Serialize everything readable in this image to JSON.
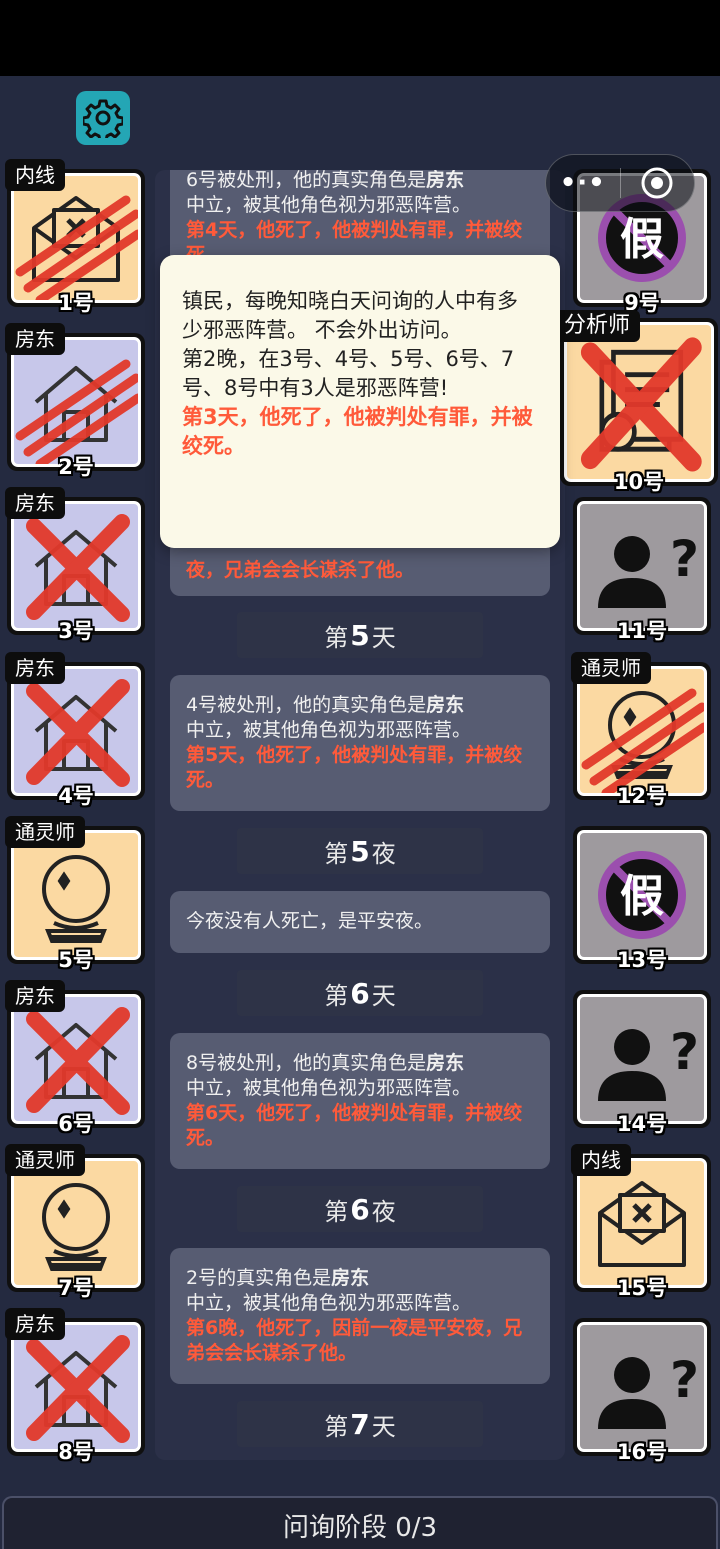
{
  "log": {
    "entries": [
      {
        "id": "e0",
        "normal": "6号被处刑，他的真实角色是",
        "bold": "房东",
        "line2": "中立，被其他角色视为邪恶阵营。",
        "red": "第4天，他死了，他被判处有罪，并被绞死。"
      },
      {
        "id": "e1",
        "red": "夜，兄弟会会长谋杀了他。"
      },
      {
        "id": "e2",
        "normal": "4号被处刑，他的真实角色是",
        "bold": "房东",
        "line2": "中立，被其他角色视为邪恶阵营。",
        "red": "第5天，他死了，他被判处有罪，并被绞死。"
      },
      {
        "id": "e3",
        "normal": "今夜没有人死亡，是平安夜。"
      },
      {
        "id": "e4",
        "normal": "8号被处刑，他的真实角色是",
        "bold": "房东",
        "line2": "中立，被其他角色视为邪恶阵营。",
        "red": "第6天，他死了，他被判处有罪，并被绞死。"
      },
      {
        "id": "e5",
        "normal": "2号的真实角色是",
        "bold": "房东",
        "line2": "中立，被其他角色视为邪恶阵营。",
        "red": "第6晚，他死了，因前一夜是平安夜，兄弟会会长谋杀了他。"
      }
    ],
    "headers": [
      {
        "prefix": "第",
        "num": "5",
        "suffix": "天"
      },
      {
        "prefix": "第",
        "num": "5",
        "suffix": "夜"
      },
      {
        "prefix": "第",
        "num": "6",
        "suffix": "天"
      },
      {
        "prefix": "第",
        "num": "6",
        "suffix": "夜"
      },
      {
        "prefix": "第",
        "num": "7",
        "suffix": "天"
      }
    ]
  },
  "popup": {
    "desc": "镇民，每晚知晓白天问询的人中有多少邪恶阵营。 不会外出访问。",
    "result": "第2晚，在3号、4号、5号、6号、7号、8号中有3人是邪恶阵营!",
    "death": "第3天，他死了，他被判处有罪，并被绞死。"
  },
  "players_left": [
    {
      "number": "1号",
      "role": "内线",
      "icon": "envelope-icon",
      "state": "slashed"
    },
    {
      "number": "2号",
      "role": "房东",
      "icon": "house-icon",
      "state": "slashed"
    },
    {
      "number": "3号",
      "role": "房东",
      "icon": "house-icon",
      "state": "crossed"
    },
    {
      "number": "4号",
      "role": "房东",
      "icon": "house-icon",
      "state": "crossed"
    },
    {
      "number": "5号",
      "role": "通灵师",
      "icon": "crystal-ball-icon",
      "state": "alive"
    },
    {
      "number": "6号",
      "role": "房东",
      "icon": "house-icon",
      "state": "crossed"
    },
    {
      "number": "7号",
      "role": "通灵师",
      "icon": "crystal-ball-icon",
      "state": "alive"
    },
    {
      "number": "8号",
      "role": "房东",
      "icon": "house-icon",
      "state": "crossed"
    }
  ],
  "players_right": [
    {
      "number": "9号",
      "role": "",
      "icon": "fake-stamp-icon",
      "state": "fake"
    },
    {
      "number": "10号",
      "role": "分析师",
      "icon": "documents-icon",
      "state": "crossed"
    },
    {
      "number": "11号",
      "role": "",
      "icon": "unknown-user-icon",
      "state": "unknown"
    },
    {
      "number": "12号",
      "role": "通灵师",
      "icon": "crystal-ball-icon",
      "state": "slashed"
    },
    {
      "number": "13号",
      "role": "",
      "icon": "fake-stamp-icon",
      "state": "fake"
    },
    {
      "number": "14号",
      "role": "",
      "icon": "unknown-user-icon",
      "state": "unknown"
    },
    {
      "number": "15号",
      "role": "内线",
      "icon": "envelope-icon",
      "state": "alive"
    },
    {
      "number": "16号",
      "role": "",
      "icon": "unknown-user-icon",
      "state": "unknown"
    }
  ],
  "fake_stamp_text": "假",
  "bottom_bar": {
    "label": "问询阶段 0/3"
  },
  "colors": {
    "red_text": "#ff5a3a",
    "slash_red": "#e2392b",
    "settings_teal": "#24a6b5",
    "bg": "#242a40"
  }
}
